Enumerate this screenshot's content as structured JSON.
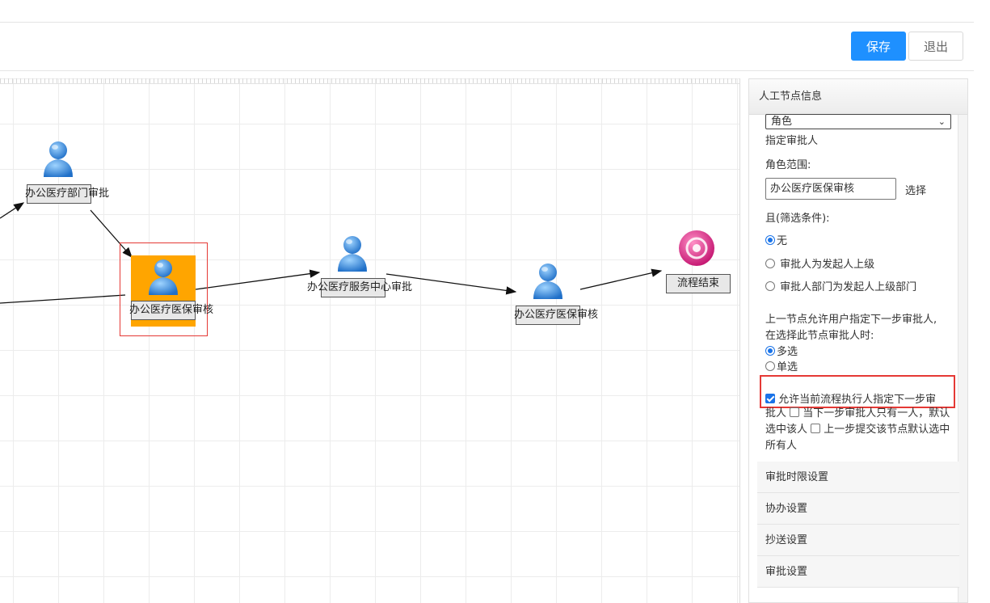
{
  "toolbar": {
    "save_label": "保存",
    "exit_label": "退出"
  },
  "canvas": {
    "nodes": [
      {
        "label": "办公医疗部门审批"
      },
      {
        "label": "办公医疗医保审核"
      },
      {
        "label": "办公医疗服务中心审批"
      },
      {
        "label": "办公医疗医保审核"
      },
      {
        "label": "流程结束"
      }
    ]
  },
  "panel": {
    "title": "人工节点信息",
    "approver_type_selected": "角色",
    "designate_label": "指定审批人",
    "role_range_label": "角色范围:",
    "role_range_value": "办公医疗医保审核",
    "select_link": "选择",
    "filter_label": "且(筛选条件):",
    "filter_options": [
      {
        "label": "无",
        "checked": true
      },
      {
        "label": "审批人为发起人上级",
        "checked": false
      },
      {
        "label": "审批人部门为发起人上级部门",
        "checked": false
      }
    ],
    "prev_node_line1": "上一节点允许用户指定下一步审批人,",
    "prev_node_line2": "在选择此节点审批人时:",
    "mode_options": [
      {
        "label": "多选",
        "checked": true
      },
      {
        "label": "单选",
        "checked": false
      }
    ],
    "allow_checkbox_label_line1": "允许当前流程执行人指定下一步审",
    "allow_checkbox_label_line2": "批人",
    "only_one_label": "当下一步审批人只有一人，默认选中该人",
    "select_all_label": "上一步提交该节点默认选中所有人",
    "sections": [
      {
        "label": "审批时限设置"
      },
      {
        "label": "协办设置"
      },
      {
        "label": "抄送设置"
      },
      {
        "label": "审批设置"
      }
    ]
  }
}
